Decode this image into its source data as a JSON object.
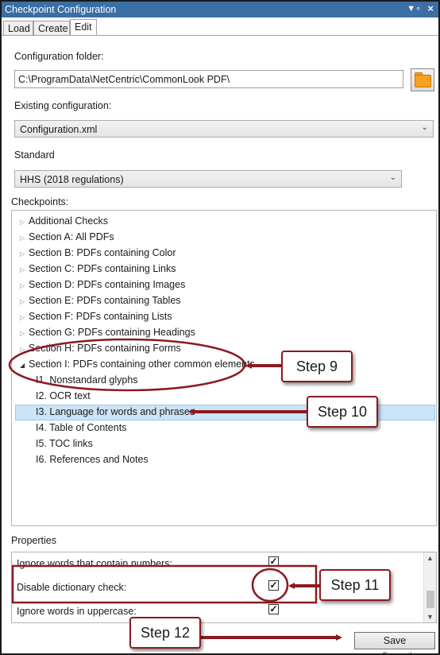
{
  "window": {
    "title": "Checkpoint Configuration",
    "pin_icon": "pin-icon",
    "close_icon": "close-icon"
  },
  "tabs": [
    {
      "label": "Load"
    },
    {
      "label": "Create"
    },
    {
      "label": "Edit",
      "active": true
    }
  ],
  "config_folder": {
    "label": "Configuration folder:",
    "value": "C:\\ProgramData\\NetCentric\\CommonLook PDF\\"
  },
  "existing_config": {
    "label": "Existing configuration:",
    "value": "Configuration.xml"
  },
  "standard": {
    "label": "Standard",
    "value": "HHS (2018 regulations)"
  },
  "checkpoints": {
    "label": "Checkpoints:",
    "sections": [
      {
        "label": "Additional Checks",
        "expanded": false
      },
      {
        "label": "Section A: All PDFs",
        "expanded": false
      },
      {
        "label": "Section B: PDFs containing Color",
        "expanded": false
      },
      {
        "label": "Section C: PDFs containing Links",
        "expanded": false
      },
      {
        "label": "Section D: PDFs containing Images",
        "expanded": false
      },
      {
        "label": "Section E: PDFs containing Tables",
        "expanded": false
      },
      {
        "label": "Section F: PDFs containing Lists",
        "expanded": false
      },
      {
        "label": "Section G: PDFs containing Headings",
        "expanded": false
      },
      {
        "label": "Section H: PDFs containing Forms",
        "expanded": false
      },
      {
        "label": "Section I: PDFs containing other common elements",
        "expanded": true
      }
    ],
    "children": [
      {
        "label": "I1. Nonstandard glyphs"
      },
      {
        "label": "I2. OCR text"
      },
      {
        "label": "I3. Language for words and phrases",
        "selected": true
      },
      {
        "label": "I4. Table of Contents"
      },
      {
        "label": "I5. TOC links"
      },
      {
        "label": "I6. References and Notes"
      }
    ]
  },
  "properties": {
    "label": "Properties",
    "rows": [
      {
        "label": "Ignore words that contain numbers:",
        "checked": true
      },
      {
        "label": "Disable dictionary check:",
        "checked": true
      },
      {
        "label": "Ignore words in uppercase:",
        "checked": true
      }
    ]
  },
  "save_button": {
    "label": "Save configuration"
  },
  "annotations": {
    "step9": "Step 9",
    "step10": "Step 10",
    "step11": "Step 11",
    "step12": "Step 12",
    "color": "#8b1a1f"
  }
}
